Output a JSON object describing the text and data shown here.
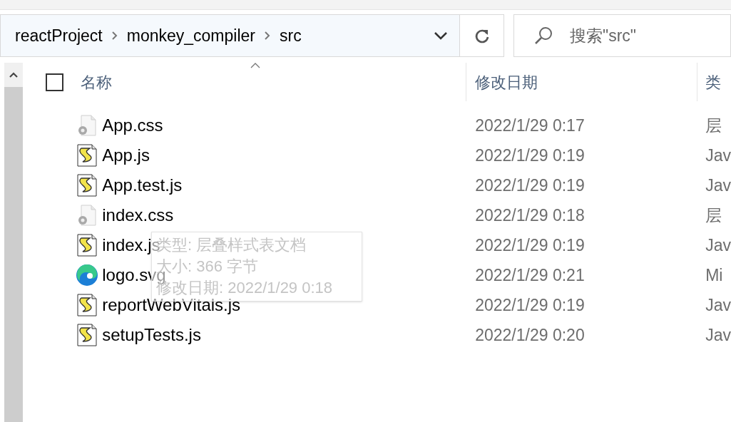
{
  "address_bar": {
    "breadcrumbs": [
      "reactProject",
      "monkey_compiler",
      "src"
    ]
  },
  "search": {
    "placeholder": "搜索\"src\""
  },
  "select_all": {
    "checked": false
  },
  "columns": [
    {
      "label": "名称",
      "sorted": true
    },
    {
      "label": "修改日期",
      "sorted": false
    },
    {
      "label": "类",
      "sorted": false
    }
  ],
  "files": [
    {
      "name": "App.css",
      "modified": "2022/1/29 0:17",
      "type": "层",
      "kind": "css"
    },
    {
      "name": "App.js",
      "modified": "2022/1/29 0:19",
      "type": "Jav",
      "kind": "js"
    },
    {
      "name": "App.test.js",
      "modified": "2022/1/29 0:19",
      "type": "Jav",
      "kind": "js"
    },
    {
      "name": "index.css",
      "modified": "2022/1/29 0:18",
      "type": "层",
      "kind": "css"
    },
    {
      "name": "index.js",
      "modified": "2022/1/29 0:19",
      "type": "Jav",
      "kind": "js"
    },
    {
      "name": "logo.svg",
      "modified": "2022/1/29 0:21",
      "type": "Mi",
      "kind": "svg"
    },
    {
      "name": "reportWebVitals.js",
      "modified": "2022/1/29 0:19",
      "type": "Jav",
      "kind": "js"
    },
    {
      "name": "setupTests.js",
      "modified": "2022/1/29 0:20",
      "type": "Jav",
      "kind": "js"
    }
  ],
  "tooltip": {
    "lines": [
      "类型: 层叠样式表文档",
      "大小: 366 字节",
      "修改日期: 2022/1/29 0:18"
    ]
  }
}
